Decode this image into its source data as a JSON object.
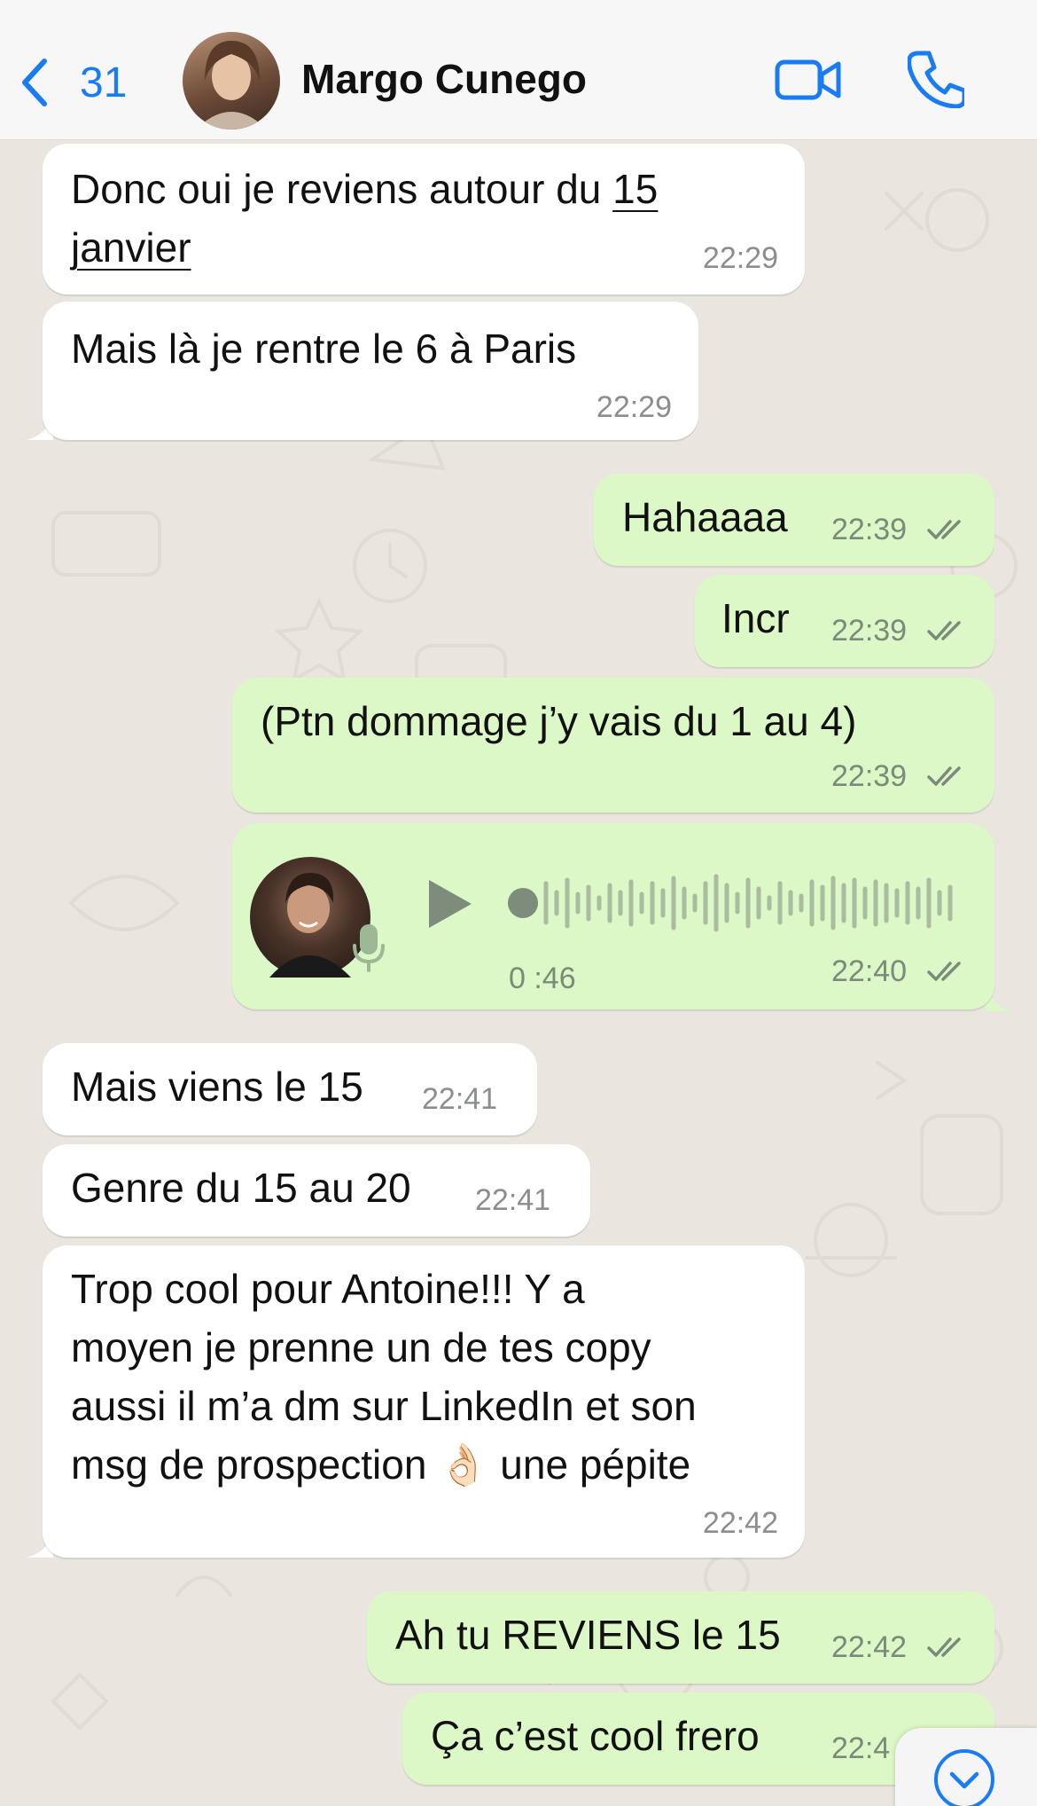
{
  "header": {
    "back_count": "31",
    "contact_name": "Margo Cunego"
  },
  "icons": {
    "back": "chevron-left-icon",
    "video": "video-camera-icon",
    "call": "phone-icon",
    "ticks": "double-check-icon",
    "play": "play-icon",
    "mic": "microphone-icon",
    "scroll": "chevron-down-circle-icon"
  },
  "colors": {
    "accent": "#1A7CF5",
    "incoming_bubble": "#FFFFFF",
    "outgoing_bubble": "#DCF8C6",
    "chat_background": "#EAE6DF"
  },
  "messages": [
    {
      "direction": "in",
      "lines": [
        "Donc oui je reviens autour du",
        "15",
        "janvier"
      ],
      "time": "22:29"
    },
    {
      "direction": "in",
      "text": "Mais là je rentre le 6 à Paris",
      "time": "22:29"
    },
    {
      "direction": "out",
      "text": "Hahaaaa",
      "time": "22:39"
    },
    {
      "direction": "out",
      "text": "Incr",
      "time": "22:39"
    },
    {
      "direction": "out",
      "text": "(Ptn dommage j’y vais du 1 au 4)",
      "time": "22:39"
    },
    {
      "direction": "out",
      "type": "voice",
      "duration": "0 :46",
      "time": "22:40"
    },
    {
      "direction": "in",
      "text": "Mais viens le 15",
      "time": "22:41"
    },
    {
      "direction": "in",
      "text": "Genre du 15 au 20",
      "time": "22:41"
    },
    {
      "direction": "in",
      "lines": [
        "Trop cool pour Antoine!!! Y a",
        "moyen je prenne un de tes copy",
        "aussi il m’a dm sur LinkedIn et son",
        "msg de prospection",
        "👌🏻",
        "une pépite"
      ],
      "time": "22:42"
    },
    {
      "direction": "out",
      "text": "Ah tu REVIENS le 15",
      "time": "22:42"
    },
    {
      "direction": "out",
      "text": "Ça c’est cool frero",
      "time": "22:4"
    }
  ]
}
